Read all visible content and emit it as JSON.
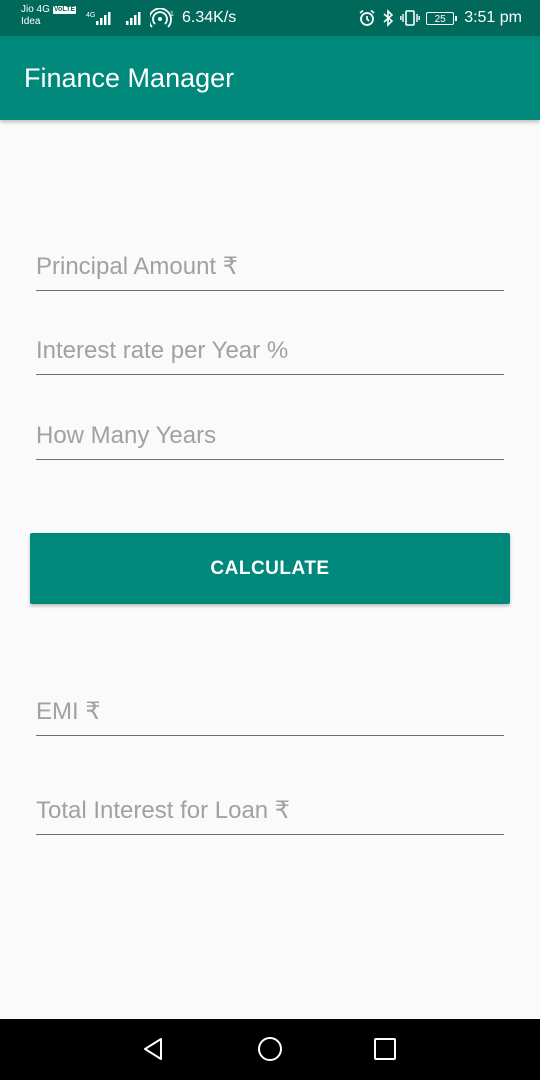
{
  "status_bar": {
    "carrier_line1": "Jio 4G",
    "volte_badge": "VoLTE",
    "carrier_line2": "Idea",
    "network_speed": "6.34K/s",
    "battery_level": "25",
    "time": "3:51 pm",
    "icons": [
      "signal-4g-icon",
      "signal-icon",
      "hotspot-icon",
      "alarm-icon",
      "bluetooth-icon",
      "vibrate-icon",
      "battery-icon"
    ]
  },
  "app_bar": {
    "title": "Finance Manager",
    "color": "#00897b"
  },
  "form": {
    "principal_placeholder": "Principal Amount ₹",
    "rate_placeholder": "Interest rate per Year %",
    "years_placeholder": "How Many Years",
    "calculate_label": "CALCULATE",
    "emi_placeholder": "EMI ₹",
    "total_interest_placeholder": "Total Interest for Loan ₹"
  },
  "nav_bar": {
    "icons": [
      "back-icon",
      "home-icon",
      "recent-apps-icon"
    ]
  }
}
